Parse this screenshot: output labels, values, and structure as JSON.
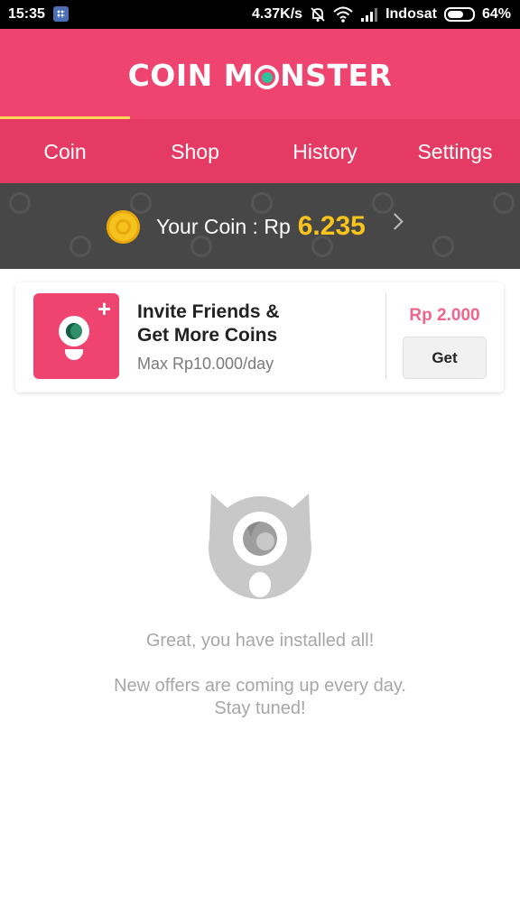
{
  "status_bar": {
    "time": "15:35",
    "speed": "4.37K/s",
    "carrier": "Indosat",
    "battery": "64%",
    "icons": [
      "bbm-icon",
      "mute-bell-icon",
      "wifi-icon",
      "signal-icon",
      "battery-icon"
    ]
  },
  "header": {
    "logo_text_left": "COIN M",
    "logo_text_right": "NSTER",
    "background": "#ef4470"
  },
  "tabs": [
    {
      "label": "Coin",
      "active": true
    },
    {
      "label": "Shop",
      "active": false
    },
    {
      "label": "History",
      "active": false
    },
    {
      "label": "Settings",
      "active": false
    }
  ],
  "coin_balance": {
    "label": "Your Coin : Rp",
    "value": "6.235",
    "value_color": "#f9c41b",
    "icon": "coin-icon"
  },
  "offer": {
    "title": "Invite Friends & Get More Coins",
    "subtitle": "Max Rp10.000/day",
    "price": "Rp 2.000",
    "button_label": "Get",
    "price_color": "#f0658b"
  },
  "empty_state": {
    "message": "Great, you have installed all!",
    "submessage_line1": "New offers are coming up every day.",
    "submessage_line2": "Stay tuned!"
  }
}
